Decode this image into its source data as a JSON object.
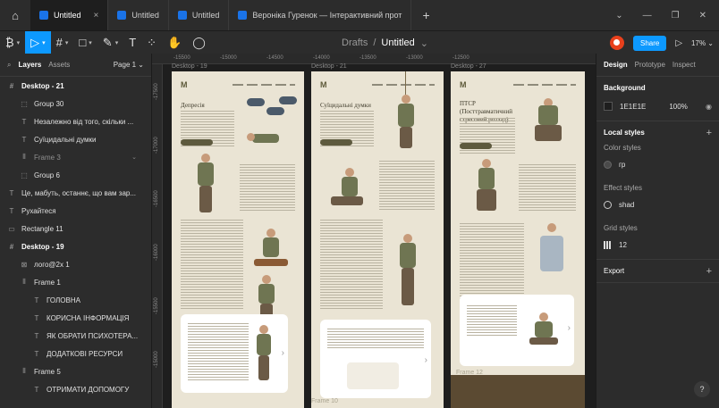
{
  "titlebar": {
    "tabs": [
      {
        "label": "Untitled",
        "active": true,
        "close": "×"
      },
      {
        "label": "Untitled",
        "active": false
      },
      {
        "label": "Untitled",
        "active": false
      },
      {
        "label": "Вероніка Гуренок — Інтерактивний прот",
        "active": false
      }
    ],
    "plus": "+",
    "window": {
      "min": "—",
      "restore": "❐",
      "close": "✕"
    }
  },
  "toolbar": {
    "breadcrumb_project": "Drafts",
    "breadcrumb_sep": "/",
    "file_name": "Untitled",
    "file_caret": "⌄",
    "share_label": "Share",
    "zoom": "17%"
  },
  "left_panel": {
    "tabs": {
      "layers": "Layers",
      "assets": "Assets",
      "page": "Page 1"
    },
    "layers": [
      {
        "label": "Desktop - 21",
        "indent": 0,
        "icon": "#",
        "style": "bold"
      },
      {
        "label": "Group 30",
        "indent": 1,
        "icon": "⬚",
        "style": "normal"
      },
      {
        "label": "Незалежно від того, скільки ...",
        "indent": 1,
        "icon": "T",
        "style": "normal"
      },
      {
        "label": "Суїцидальні думки",
        "indent": 1,
        "icon": "T",
        "style": "normal"
      },
      {
        "label": "Frame 3",
        "indent": 1,
        "icon": "⦀",
        "style": "dim",
        "chevron": "⌄"
      },
      {
        "label": "Group 6",
        "indent": 1,
        "icon": "⬚",
        "style": "normal"
      },
      {
        "label": "Це, мабуть, останнє, що вам зар...",
        "indent": 0,
        "icon": "T",
        "style": "normal"
      },
      {
        "label": "Рухайтеся",
        "indent": 0,
        "icon": "T",
        "style": "normal"
      },
      {
        "label": "Rectangle 11",
        "indent": 0,
        "icon": "▭",
        "style": "normal"
      },
      {
        "label": "Desktop - 19",
        "indent": 0,
        "icon": "#",
        "style": "bold"
      },
      {
        "label": "лого@2x 1",
        "indent": 1,
        "icon": "⊠",
        "style": "normal"
      },
      {
        "label": "Frame 1",
        "indent": 1,
        "icon": "⦀",
        "style": "normal"
      },
      {
        "label": "ГОЛОВНА",
        "indent": 2,
        "icon": "T",
        "style": "normal"
      },
      {
        "label": "КОРИСНА ІНФОРМАЦІЯ",
        "indent": 2,
        "icon": "T",
        "style": "normal"
      },
      {
        "label": "ЯК ОБРАТИ ПСИХОТЕРА...",
        "indent": 2,
        "icon": "T",
        "style": "normal"
      },
      {
        "label": "ДОДАТКОВІ РЕСУРСИ",
        "indent": 2,
        "icon": "T",
        "style": "normal"
      },
      {
        "label": "Frame 5",
        "indent": 1,
        "icon": "⦀",
        "style": "normal"
      },
      {
        "label": "ОТРИМАТИ ДОПОМОГУ",
        "indent": 2,
        "icon": "T",
        "style": "normal"
      }
    ]
  },
  "canvas": {
    "ruler_h": [
      "-15500",
      "-15000",
      "-14500",
      "-14000",
      "-13500",
      "-13000",
      "-12500"
    ],
    "ruler_v": [
      "-17500",
      "-17000",
      "-16500",
      "-16000",
      "-15500",
      "-15000"
    ],
    "frames": [
      {
        "label": "Desktop - 19",
        "title": "Депресія"
      },
      {
        "label": "Desktop - 21",
        "title": "Суїцидальні думки"
      },
      {
        "label": "Desktop - 27",
        "title": "ПТСР (Посттравматичний стресовий розлад)"
      }
    ],
    "frame_overlay_1": "Frame 10",
    "frame_overlay_2": "Frame 12"
  },
  "right_panel": {
    "tabs": {
      "design": "Design",
      "prototype": "Prototype",
      "inspect": "Inspect"
    },
    "background": {
      "title": "Background",
      "hex": "1E1E1E",
      "opacity": "100%"
    },
    "local_styles": {
      "title": "Local styles",
      "color_styles": "Color styles",
      "color_item": "гр",
      "effect_styles": "Effect styles",
      "effect_item": "shad",
      "grid_styles": "Grid styles",
      "grid_item": "12"
    },
    "export": "Export",
    "help": "?"
  },
  "colors": {
    "accent": "#0d99ff",
    "frame_bg": "#eae4d4",
    "panel": "#2c2c2c"
  }
}
